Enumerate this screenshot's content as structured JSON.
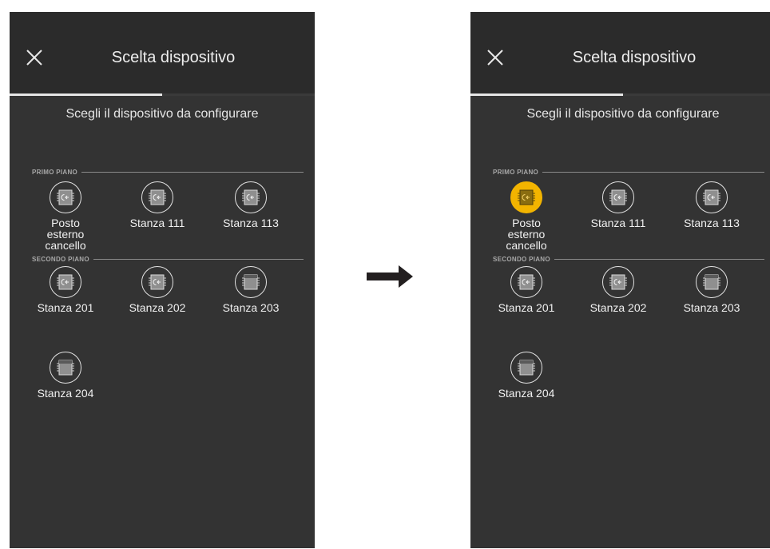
{
  "left": {
    "title": "Scelta dispositivo",
    "subtitle": "Scegli il dispositivo da configurare",
    "progress": 0.5,
    "sections": [
      "PRIMO PIANO",
      "SECONDO PIANO"
    ],
    "devices": [
      {
        "label": "Posto esterno cancello",
        "icon": "outdoor-station-icon"
      },
      {
        "label": "Stanza 111",
        "icon": "outdoor-station-icon"
      },
      {
        "label": "Stanza 113",
        "icon": "outdoor-station-icon"
      },
      {
        "label": "Stanza 201",
        "icon": "outdoor-station-icon"
      },
      {
        "label": "Stanza 202",
        "icon": "outdoor-station-icon"
      },
      {
        "label": "Stanza 203",
        "icon": "indoor-station-icon"
      },
      {
        "label": "Stanza 204",
        "icon": "indoor-station-icon"
      }
    ]
  },
  "right": {
    "title": "Scelta dispositivo",
    "subtitle": "Scegli il dispositivo da configurare",
    "progress": 0.5,
    "sections": [
      "PRIMO PIANO",
      "SECONDO PIANO"
    ],
    "selected_device": "Posto esterno cancello",
    "devices": [
      {
        "label": "Posto esterno cancello",
        "icon": "outdoor-station-icon"
      },
      {
        "label": "Stanza 111",
        "icon": "outdoor-station-icon"
      },
      {
        "label": "Stanza 113",
        "icon": "outdoor-station-icon"
      },
      {
        "label": "Stanza 201",
        "icon": "outdoor-station-icon"
      },
      {
        "label": "Stanza 202",
        "icon": "outdoor-station-icon"
      },
      {
        "label": "Stanza 203",
        "icon": "indoor-station-icon"
      },
      {
        "label": "Stanza 204",
        "icon": "indoor-station-icon"
      }
    ]
  },
  "colors": {
    "background": "#333333",
    "header": "#2b2b2b",
    "text": "#f0f0f0",
    "selected": "#f2b400",
    "arrow": "#231f20"
  },
  "transition_icon": "arrow-right-icon"
}
